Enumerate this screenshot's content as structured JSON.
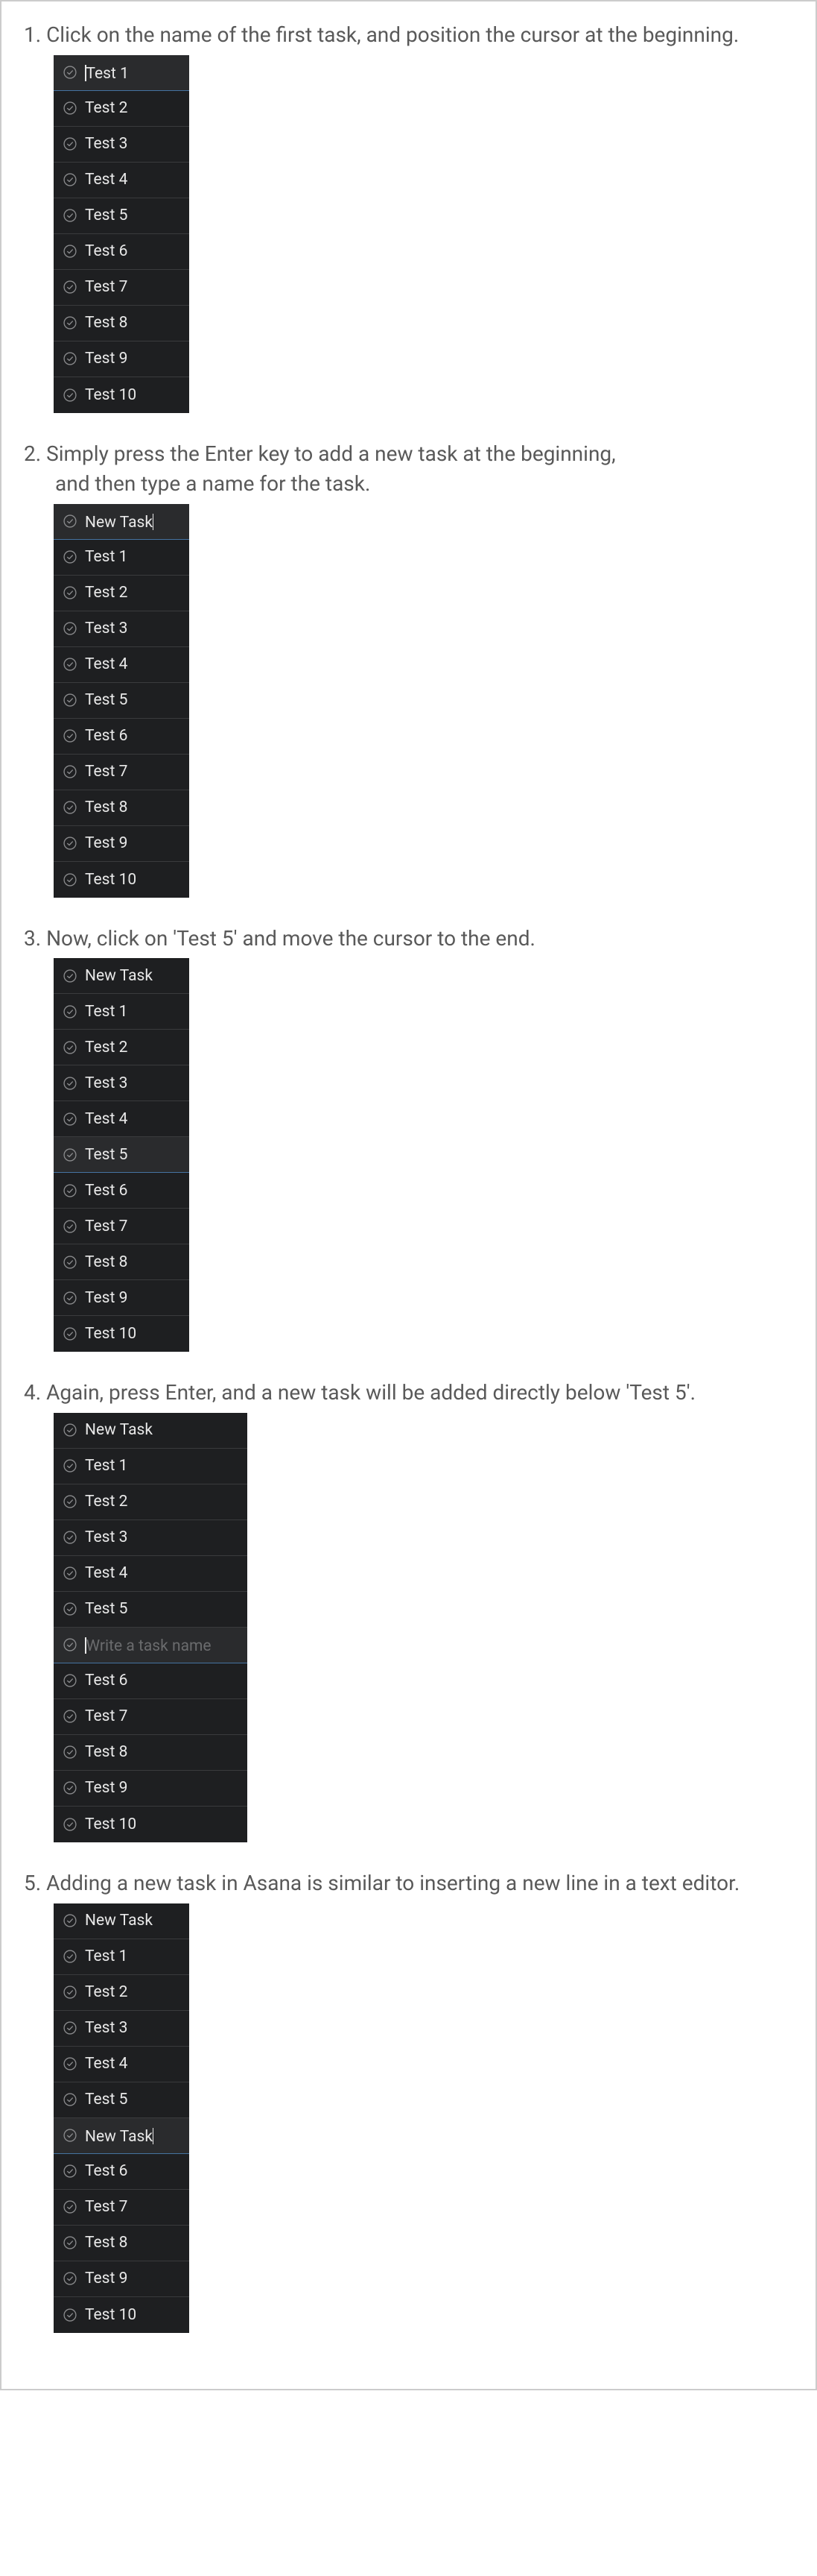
{
  "steps": [
    {
      "text": "1. Click on the name of the first task, and position the cursor at the beginning.",
      "list_class": "",
      "tasks": [
        {
          "name": "Test 1",
          "selected": true,
          "cursor": "before"
        },
        {
          "name": "Test 2"
        },
        {
          "name": "Test 3"
        },
        {
          "name": "Test 4"
        },
        {
          "name": "Test 5"
        },
        {
          "name": "Test 6"
        },
        {
          "name": "Test 7"
        },
        {
          "name": "Test 8"
        },
        {
          "name": "Test 9"
        },
        {
          "name": "Test 10"
        }
      ]
    },
    {
      "text": "2. Simply press the Enter key to add a new task at the beginning,",
      "text2": "and then type a name for the task.",
      "list_class": "",
      "tasks": [
        {
          "name": "New Task",
          "selected": true,
          "cursor": "after"
        },
        {
          "name": "Test 1"
        },
        {
          "name": "Test 2"
        },
        {
          "name": "Test 3"
        },
        {
          "name": "Test 4"
        },
        {
          "name": "Test 5"
        },
        {
          "name": "Test 6"
        },
        {
          "name": "Test 7"
        },
        {
          "name": "Test 8"
        },
        {
          "name": "Test 9"
        },
        {
          "name": "Test 10"
        }
      ]
    },
    {
      "text": "3. Now, click on 'Test 5' and move the cursor to the end.",
      "list_class": "",
      "tasks": [
        {
          "name": "New Task"
        },
        {
          "name": "Test 1"
        },
        {
          "name": "Test 2"
        },
        {
          "name": "Test 3"
        },
        {
          "name": "Test 4"
        },
        {
          "name": "Test 5",
          "selected": true
        },
        {
          "name": "Test 6"
        },
        {
          "name": "Test 7"
        },
        {
          "name": "Test 8"
        },
        {
          "name": "Test 9"
        },
        {
          "name": "Test 10"
        }
      ]
    },
    {
      "text": "4. Again, press Enter, and a new task will be added directly below 'Test 5'.",
      "list_class": "wider",
      "tasks": [
        {
          "name": "New Task"
        },
        {
          "name": "Test 1"
        },
        {
          "name": "Test 2"
        },
        {
          "name": "Test 3"
        },
        {
          "name": "Test 4"
        },
        {
          "name": "Test 5"
        },
        {
          "name": "Write a task name",
          "selected": true,
          "placeholder": true,
          "cursor": "before"
        },
        {
          "name": "Test 6"
        },
        {
          "name": "Test 7"
        },
        {
          "name": "Test 8"
        },
        {
          "name": "Test 9"
        },
        {
          "name": "Test 10"
        }
      ]
    },
    {
      "text": "5.  Adding a new task in Asana is similar to inserting a new line in a text editor.",
      "list_class": "",
      "tasks": [
        {
          "name": "New Task"
        },
        {
          "name": "Test 1"
        },
        {
          "name": "Test 2"
        },
        {
          "name": "Test 3"
        },
        {
          "name": "Test 4"
        },
        {
          "name": "Test 5"
        },
        {
          "name": "New Task",
          "selected": true,
          "cursor": "after"
        },
        {
          "name": "Test 6"
        },
        {
          "name": "Test 7"
        },
        {
          "name": "Test 8"
        },
        {
          "name": "Test 9"
        },
        {
          "name": "Test 10"
        }
      ]
    }
  ]
}
